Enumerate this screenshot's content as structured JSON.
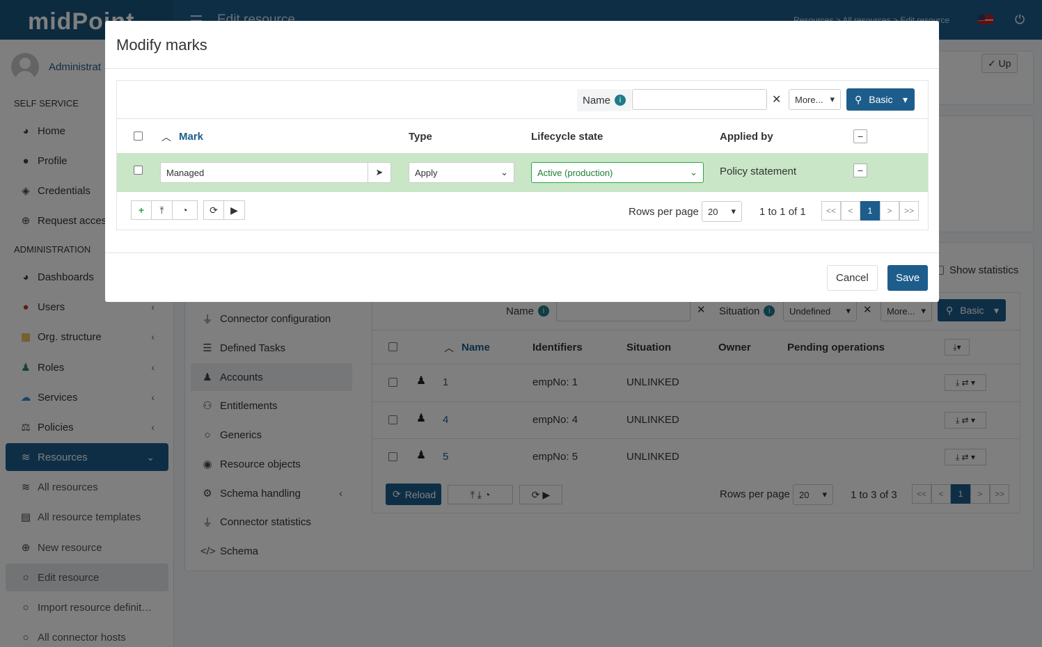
{
  "app": {
    "logo": "midPoint",
    "page_title": "Edit resource",
    "breadcrumbs": "Resources > All resources > Edit resource"
  },
  "sidebar": {
    "user_name": "Administrat",
    "self_service_header": "SELF SERVICE",
    "administration_header": "ADMINISTRATION",
    "items": [
      {
        "label": "Home",
        "icon": "dashboard-icon"
      },
      {
        "label": "Profile",
        "icon": "user-icon"
      },
      {
        "label": "Credentials",
        "icon": "shield-icon"
      },
      {
        "label": "Request access",
        "icon": "plus-circle-icon"
      }
    ],
    "admin_items": [
      {
        "label": "Dashboards",
        "icon": "dashboard-icon"
      },
      {
        "label": "Users",
        "icon": "user-icon"
      },
      {
        "label": "Org. structure",
        "icon": "building-icon"
      },
      {
        "label": "Roles",
        "icon": "role-icon"
      },
      {
        "label": "Services",
        "icon": "cloud-icon"
      },
      {
        "label": "Policies",
        "icon": "scale-icon"
      },
      {
        "label": "Resources",
        "icon": "database-icon"
      }
    ],
    "resource_sub": [
      {
        "label": "All resources",
        "icon": "database-icon"
      },
      {
        "label": "All resource templates",
        "icon": "file-icon"
      },
      {
        "label": "New resource",
        "icon": "plus-circle-icon"
      },
      {
        "label": "Edit resource",
        "icon": "circle-icon"
      },
      {
        "label": "Import resource definit…",
        "icon": "circle-icon"
      },
      {
        "label": "All connector hosts",
        "icon": "circle-icon"
      }
    ]
  },
  "background": {
    "up_button": "Up",
    "show_statistics": "Show statistics",
    "menu": [
      {
        "label": "Connector configuration",
        "icon": "plug-icon"
      },
      {
        "label": "Defined Tasks",
        "icon": "list-icon"
      },
      {
        "label": "Accounts",
        "icon": "person-icon"
      },
      {
        "label": "Entitlements",
        "icon": "users-icon"
      },
      {
        "label": "Generics",
        "icon": "circle-icon"
      },
      {
        "label": "Resource objects",
        "icon": "eye-icon"
      },
      {
        "label": "Schema handling",
        "icon": "cogs-icon"
      },
      {
        "label": "Connector statistics",
        "icon": "plug-icon"
      },
      {
        "label": "Schema",
        "icon": "code-icon"
      }
    ],
    "search": {
      "name_label": "Name",
      "situation_label": "Situation",
      "situation_value": "Undefined",
      "more_label": "More...",
      "basic_label": "Basic"
    },
    "table": {
      "headers": [
        "Name",
        "Identifiers",
        "Situation",
        "Owner",
        "Pending operations"
      ],
      "rows": [
        {
          "name": "1",
          "identifiers": "empNo: 1",
          "situation": "UNLINKED"
        },
        {
          "name": "4",
          "identifiers": "empNo: 4",
          "situation": "UNLINKED"
        },
        {
          "name": "5",
          "identifiers": "empNo: 5",
          "situation": "UNLINKED"
        }
      ]
    },
    "footer": {
      "reload_label": "Reload",
      "rows_per_page_label": "Rows per page",
      "rows_per_page_value": "20",
      "count_text": "1 to 3 of 3",
      "current_page": "1"
    }
  },
  "modal": {
    "title": "Modify marks",
    "search": {
      "name_label": "Name",
      "name_value": "",
      "more_label": "More...",
      "basic_label": "Basic"
    },
    "table": {
      "headers": [
        "Mark",
        "Type",
        "Lifecycle state",
        "Applied by"
      ],
      "row": {
        "mark": "Managed",
        "type": "Apply",
        "lifecycle": "Active (production)",
        "applied_by": "Policy statement"
      }
    },
    "footer": {
      "rows_per_page_label": "Rows per page",
      "rows_per_page_value": "20",
      "count_text": "1 to 1 of 1",
      "current_page": "1",
      "first": "<<",
      "prev": "<",
      "next": ">",
      "last": ">>"
    },
    "cancel_label": "Cancel",
    "save_label": "Save"
  }
}
